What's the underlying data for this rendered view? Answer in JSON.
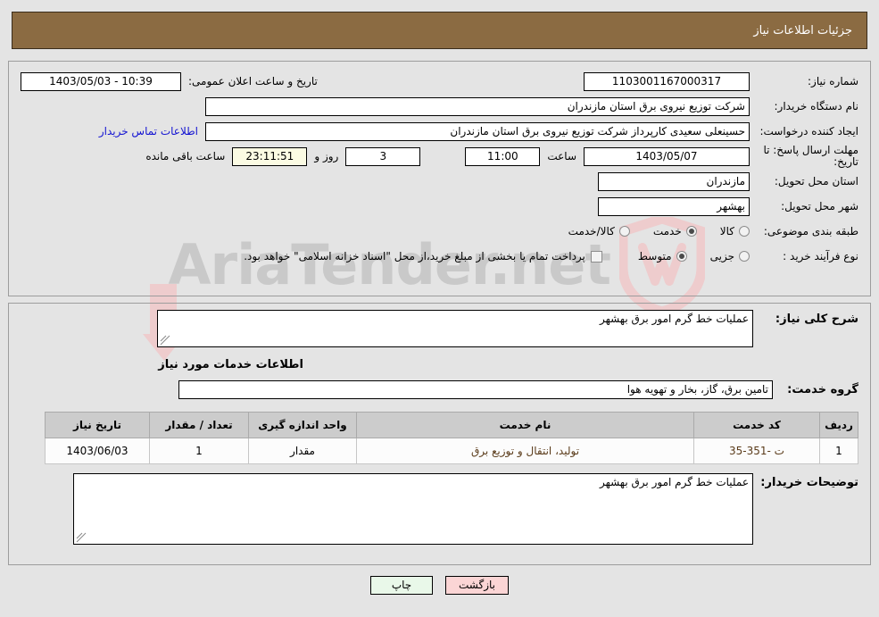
{
  "header": {
    "title": "جزئیات اطلاعات نیاز"
  },
  "watermark": {
    "text": "AriaTender.net",
    "shield_color": "#eecccd",
    "text_color": "#c9c9c9"
  },
  "colors": {
    "header_bg": "#8b6b42",
    "page_bg": "#e4e4e4",
    "link": "#1414d2",
    "countdown_bg": "#fbfbe3",
    "print_btn_bg": "#e9f8e9",
    "back_btn_bg": "#fbd5d5",
    "table_header_bg": "#cccccc",
    "table_cell_text": "#5a3b1a"
  },
  "form": {
    "need_number_label": "شماره نیاز:",
    "need_number_value": "1103001167000317",
    "public_announce_label": "تاریخ و ساعت اعلان عمومی:",
    "public_announce_value": "1403/05/03 - 10:39",
    "buyer_org_label": "نام دستگاه خریدار:",
    "buyer_org_value": "شرکت توزیع نیروی برق استان مازندران",
    "creator_label": "ایجاد کننده درخواست:",
    "creator_value": "حسینعلی سعیدی کارپرداز شرکت توزیع نیروی برق استان مازندران",
    "contact_link": "اطلاعات تماس خریدار",
    "deadline_label": "مهلت ارسال پاسخ: تا تاریخ:",
    "deadline_date": "1403/05/07",
    "hour_label": "ساعت",
    "hour_value": "11:00",
    "days_value": "3",
    "days_label": "روز و",
    "countdown_value": "23:11:51",
    "countdown_label": "ساعت باقی مانده",
    "province_label": "استان محل تحویل:",
    "province_value": "مازندران",
    "city_label": "شهر محل تحویل:",
    "city_value": "بهشهر",
    "category_label": "طبقه بندی موضوعی:",
    "category_options": [
      {
        "label": "کالا",
        "selected": false
      },
      {
        "label": "خدمت",
        "selected": true
      },
      {
        "label": "کالا/خدمت",
        "selected": false
      }
    ],
    "process_label": "نوع فرآیند خرید :",
    "process_options": [
      {
        "label": "جزیی",
        "selected": false
      },
      {
        "label": "متوسط",
        "selected": true
      }
    ],
    "treasury_checkbox_label": "پرداخت تمام یا بخشی از مبلغ خرید،از محل \"اسناد خزانه اسلامی\" خواهد بود.",
    "treasury_checked": false
  },
  "details": {
    "general_desc_label": "شرح کلی نیاز:",
    "general_desc_value": "عملیات خط گرم امور برق بهشهر",
    "services_section_title": "اطلاعات خدمات مورد نیاز",
    "service_group_label": "گروه خدمت:",
    "service_group_value": "تامین برق، گاز، بخار و تهویه هوا",
    "buyer_notes_label": "توضیحات خریدار:",
    "buyer_notes_value": "عملیات خط گرم امور برق بهشهر"
  },
  "table": {
    "headers": [
      "ردیف",
      "کد خدمت",
      "نام خدمت",
      "واحد اندازه گیری",
      "تعداد / مقدار",
      "تاریخ نیاز"
    ],
    "rows": [
      {
        "index": "1",
        "code": "ت -351-35",
        "name": "تولید، انتقال و توزیع برق",
        "unit": "مقدار",
        "qty": "1",
        "date": "1403/06/03"
      }
    ]
  },
  "footer": {
    "print_label": "چاپ",
    "back_label": "بازگشت"
  }
}
